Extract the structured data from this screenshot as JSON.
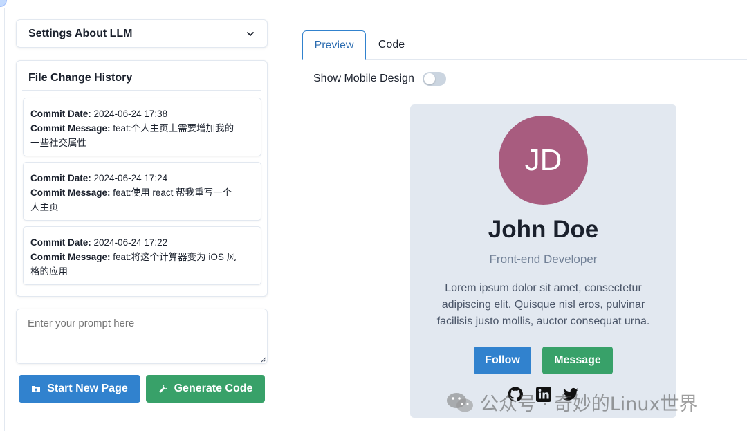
{
  "settings": {
    "title": "Settings About LLM"
  },
  "history": {
    "title": "File Change History",
    "date_label": "Commit Date:",
    "message_label": "Commit Message:",
    "commits": [
      {
        "date": "2024-06-24 17:38",
        "message_line1": "feat:个人主页上需要增加我的",
        "message_line2": "一些社交属性"
      },
      {
        "date": "2024-06-24 17:24",
        "message_line1": "feat:使用 react 帮我重写一个",
        "message_line2": "人主页"
      },
      {
        "date": "2024-06-24 17:22",
        "message_line1": "feat:将这个计算器变为 iOS 风",
        "message_line2": "格的应用"
      }
    ]
  },
  "prompt": {
    "placeholder": "Enter your prompt here"
  },
  "actions": {
    "start_label": "Start New Page",
    "generate_label": "Generate Code"
  },
  "tabs": [
    {
      "label": "Preview",
      "active": true
    },
    {
      "label": "Code",
      "active": false
    }
  ],
  "mobile_toggle": {
    "label": "Show Mobile Design",
    "on": false
  },
  "profile": {
    "initials": "JD",
    "name": "John Doe",
    "role": "Front-end Developer",
    "bio": "Lorem ipsum dolor sit amet, consectetur adipiscing elit. Quisque nisl eros, pulvinar facilisis justo mollis, auctor consequat urna.",
    "follow_label": "Follow",
    "message_label": "Message",
    "social_icons": [
      "github-icon",
      "linkedin-icon",
      "twitter-icon"
    ]
  },
  "watermark": {
    "text": "公众号 · 奇妙的Linux世界"
  },
  "colors": {
    "primary": "#3182ce",
    "success": "#38a169",
    "avatar": "#a85c7f",
    "card_bg": "#e2e8f0"
  }
}
